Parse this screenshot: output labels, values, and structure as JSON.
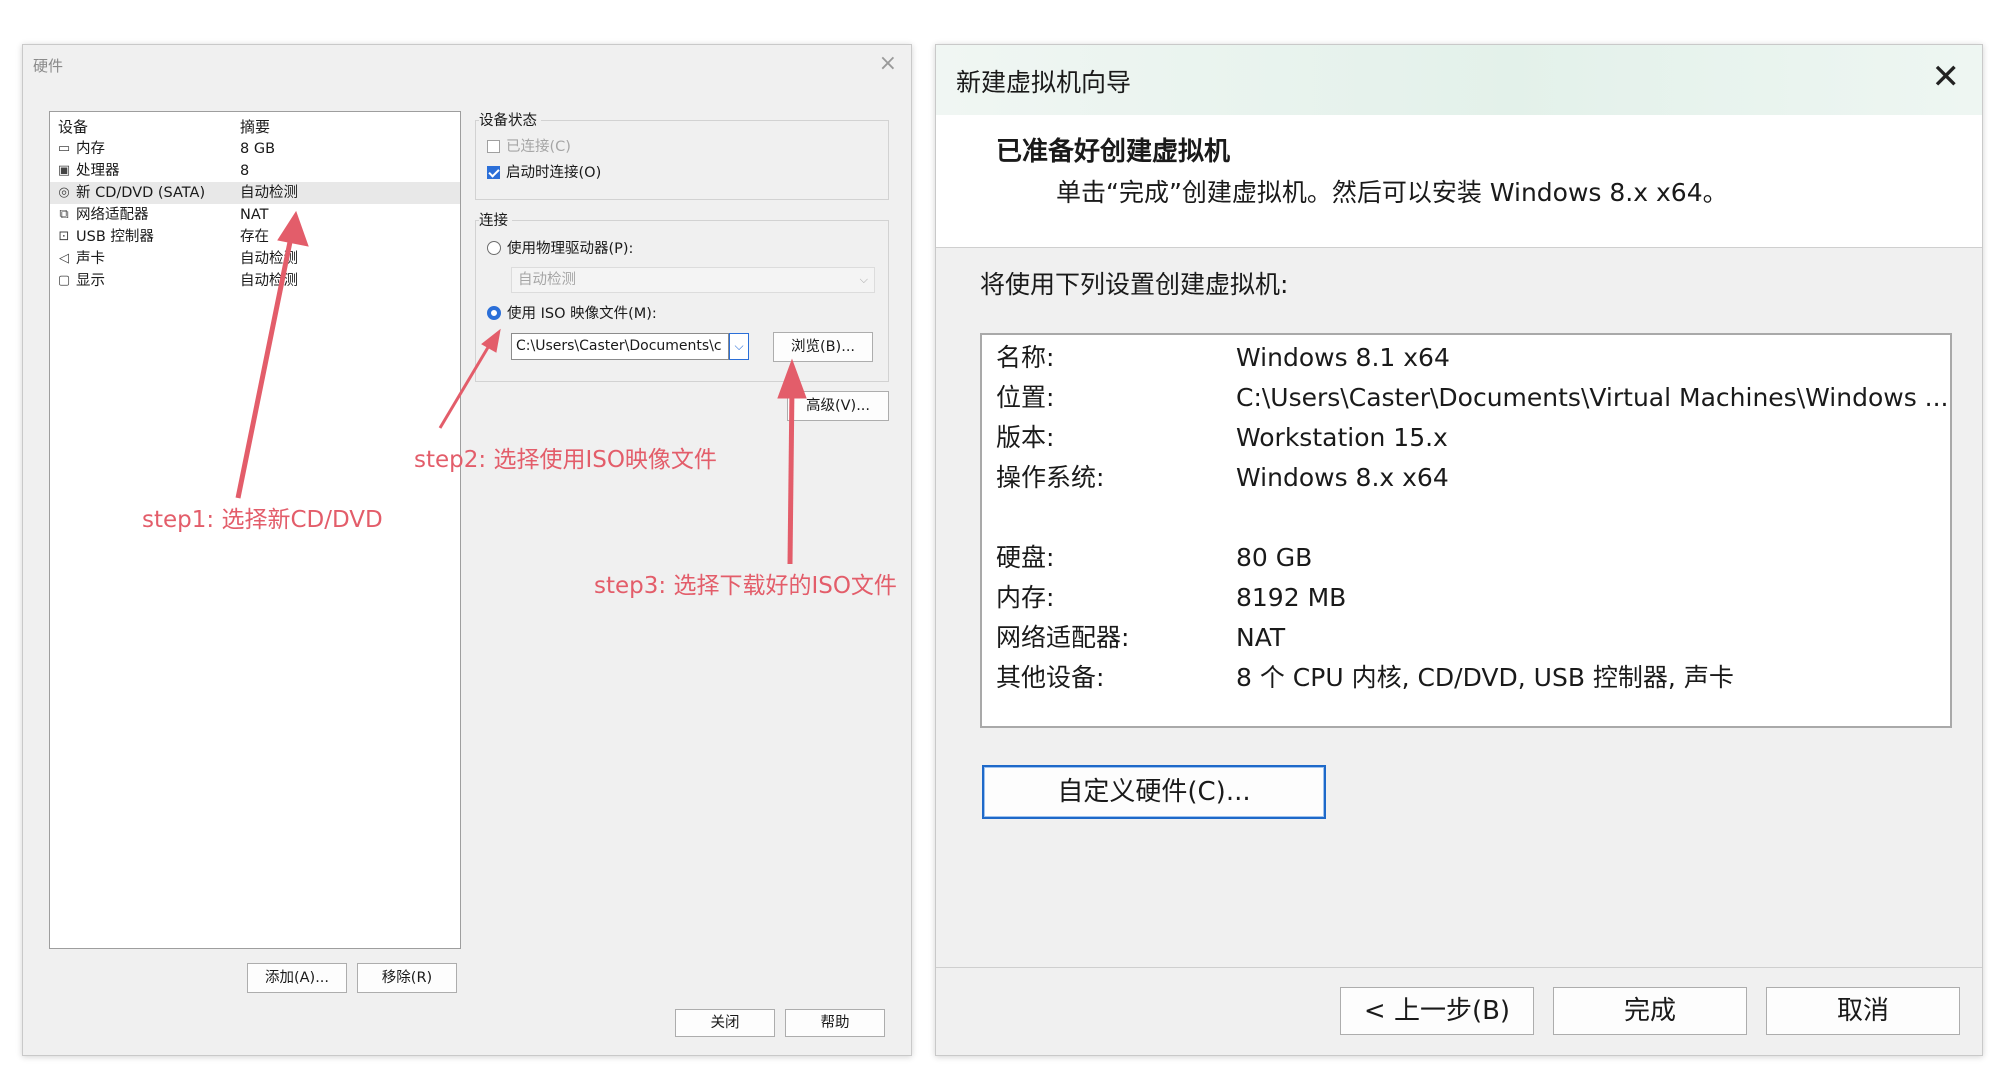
{
  "hardware_dialog": {
    "title": "硬件",
    "close_glyph": "×",
    "list_header": {
      "device": "设备",
      "summary": "摘要"
    },
    "devices": [
      {
        "icon": "memory-icon",
        "name": "内存",
        "summary": "8 GB"
      },
      {
        "icon": "cpu-icon",
        "name": "处理器",
        "summary": "8"
      },
      {
        "icon": "cd-dvd-icon",
        "name": "新 CD/DVD (SATA)",
        "summary": "自动检测"
      },
      {
        "icon": "network-adapter-icon",
        "name": "网络适配器",
        "summary": "NAT"
      },
      {
        "icon": "usb-icon",
        "name": "USB 控制器",
        "summary": "存在"
      },
      {
        "icon": "speaker-icon",
        "name": "声卡",
        "summary": "自动检测"
      },
      {
        "icon": "display-icon",
        "name": "显示",
        "summary": "自动检测"
      }
    ],
    "add_button": "添加(A)...",
    "remove_button": "移除(R)",
    "device_status": {
      "label": "设备状态",
      "connected": "已连接(C)",
      "connect_at_power_on": "启动时连接(O)"
    },
    "connection": {
      "label": "连接",
      "use_physical_drive": "使用物理驱动器(P):",
      "physical_drive_value": "自动检测",
      "use_iso": "使用 ISO 映像文件(M):",
      "iso_path": "C:\\Users\\Caster\\Documents\\c",
      "browse_button": "浏览(B)..."
    },
    "advanced_button": "高级(V)...",
    "close_button": "关闭",
    "help_button": "帮助"
  },
  "annotations": {
    "step1": "step1: 选择新CD/DVD",
    "step2": "step2: 选择使用ISO映像文件",
    "step3": "step3: 选择下载好的ISO文件",
    "color": "#e35d6a"
  },
  "wizard_dialog": {
    "title": "新建虚拟机向导",
    "close_glyph": "✕",
    "heading": "已准备好创建虚拟机",
    "subheading": "单击“完成”创建虚拟机。然后可以安装 Windows 8.x x64。",
    "lead": "将使用下列设置创建虚拟机:",
    "summary": [
      {
        "key": "名称:",
        "value": "Windows 8.1 x64"
      },
      {
        "key": "位置:",
        "value": "C:\\Users\\Caster\\Documents\\Virtual Machines\\Windows ..."
      },
      {
        "key": "版本:",
        "value": "Workstation 15.x"
      },
      {
        "key": "操作系统:",
        "value": "Windows 8.x x64"
      },
      {
        "key": "硬盘:",
        "value": "80 GB"
      },
      {
        "key": "内存:",
        "value": "8192 MB"
      },
      {
        "key": "网络适配器:",
        "value": "NAT"
      },
      {
        "key": "其他设备:",
        "value": "8 个 CPU 内核, CD/DVD, USB 控制器, 声卡"
      }
    ],
    "customize_button": "自定义硬件(C)...",
    "back_button": "< 上一步(B)",
    "finish_button": "完成",
    "cancel_button": "取消"
  }
}
